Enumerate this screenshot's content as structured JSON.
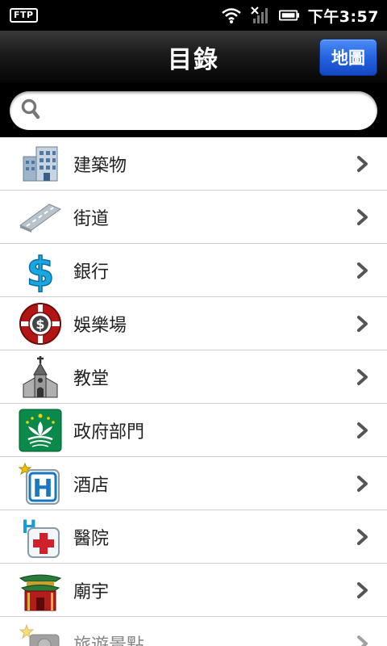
{
  "status_bar": {
    "ftp_label": "FTP",
    "time": "下午3:57"
  },
  "header": {
    "title": "目錄",
    "map_button_label": "地圖"
  },
  "search": {
    "placeholder": "",
    "value": ""
  },
  "list": {
    "items": [
      {
        "label": "建築物",
        "icon": "building-icon"
      },
      {
        "label": "街道",
        "icon": "street-icon"
      },
      {
        "label": "銀行",
        "icon": "dollar-icon"
      },
      {
        "label": "娛樂場",
        "icon": "casino-chip-icon"
      },
      {
        "label": "教堂",
        "icon": "church-icon"
      },
      {
        "label": "政府部門",
        "icon": "macau-flag-icon"
      },
      {
        "label": "酒店",
        "icon": "hotel-icon"
      },
      {
        "label": "醫院",
        "icon": "hospital-icon"
      },
      {
        "label": "廟宇",
        "icon": "temple-icon"
      },
      {
        "label": "旅遊景點",
        "icon": "tourist-camera-icon"
      }
    ]
  },
  "colors": {
    "map_button": "#2563e0",
    "header_bg": "#1a1a1a",
    "divider": "#cfcfcf"
  }
}
